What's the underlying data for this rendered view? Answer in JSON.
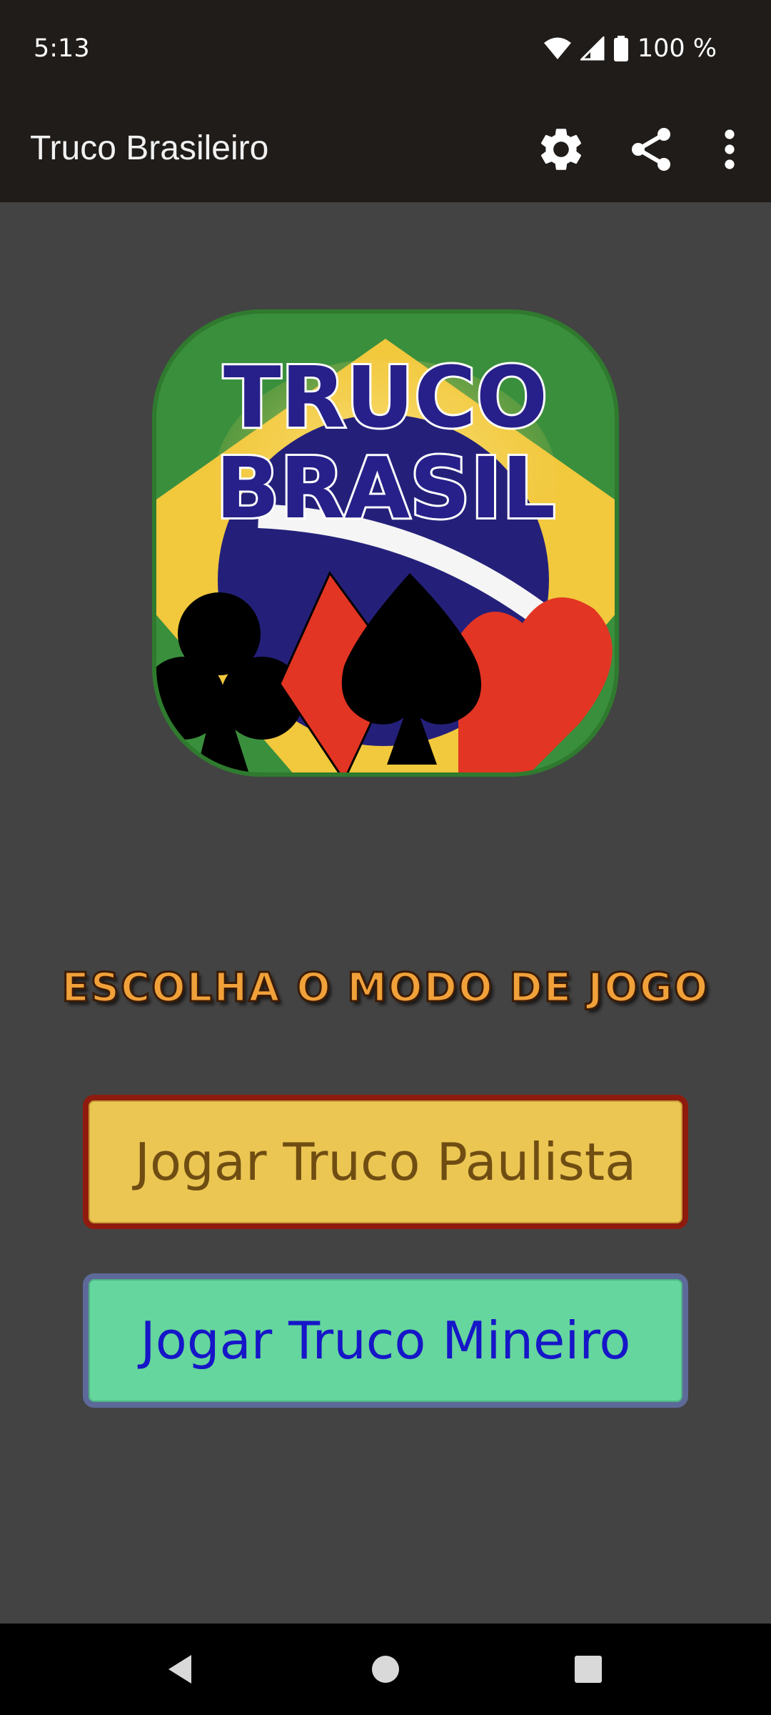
{
  "status_bar": {
    "time": "5:13",
    "battery_text": "100 %",
    "icons": [
      "wifi-icon",
      "cell-signal-icon",
      "battery-icon"
    ]
  },
  "app_bar": {
    "title": "Truco Brasileiro",
    "actions": [
      "gear-icon",
      "share-icon",
      "more-vert-icon"
    ]
  },
  "logo": {
    "line1": "TRUCO",
    "line2": "BRASIL"
  },
  "main": {
    "subtitle": "ESCOLHA O MODO DE JOGO",
    "buttons": [
      {
        "label": "Jogar Truco Paulista",
        "bg": "#ebc653",
        "border": "#8f1b0f",
        "text": "#6f4d12"
      },
      {
        "label": "Jogar Truco Mineiro",
        "bg": "#65d69d",
        "border": "#5d6a99",
        "text": "#1616c8"
      }
    ]
  },
  "nav_bar": {
    "buttons": [
      "back-icon",
      "home-icon",
      "recents-icon"
    ]
  },
  "colors": {
    "background": "#434343",
    "bars": "#1f1c19",
    "flag_green": "#3a8f3d",
    "flag_yellow": "#f2c83d",
    "flag_blue": "#24207a"
  }
}
